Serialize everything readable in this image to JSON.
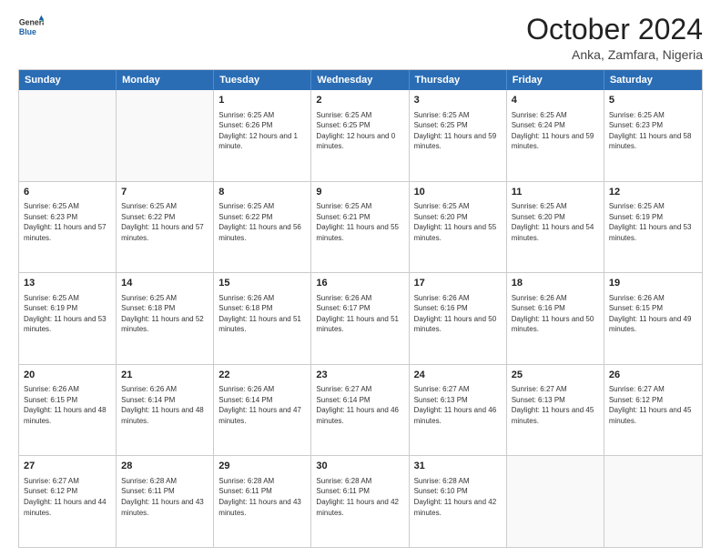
{
  "logo": {
    "line1": "General",
    "line2": "Blue"
  },
  "title": "October 2024",
  "location": "Anka, Zamfara, Nigeria",
  "header_days": [
    "Sunday",
    "Monday",
    "Tuesday",
    "Wednesday",
    "Thursday",
    "Friday",
    "Saturday"
  ],
  "weeks": [
    [
      {
        "day": "",
        "empty": true
      },
      {
        "day": "",
        "empty": true
      },
      {
        "day": "1",
        "rise": "6:25 AM",
        "set": "6:26 PM",
        "daylight": "12 hours and 1 minute."
      },
      {
        "day": "2",
        "rise": "6:25 AM",
        "set": "6:25 PM",
        "daylight": "12 hours and 0 minutes."
      },
      {
        "day": "3",
        "rise": "6:25 AM",
        "set": "6:25 PM",
        "daylight": "11 hours and 59 minutes."
      },
      {
        "day": "4",
        "rise": "6:25 AM",
        "set": "6:24 PM",
        "daylight": "11 hours and 59 minutes."
      },
      {
        "day": "5",
        "rise": "6:25 AM",
        "set": "6:23 PM",
        "daylight": "11 hours and 58 minutes."
      }
    ],
    [
      {
        "day": "6",
        "rise": "6:25 AM",
        "set": "6:23 PM",
        "daylight": "11 hours and 57 minutes."
      },
      {
        "day": "7",
        "rise": "6:25 AM",
        "set": "6:22 PM",
        "daylight": "11 hours and 57 minutes."
      },
      {
        "day": "8",
        "rise": "6:25 AM",
        "set": "6:22 PM",
        "daylight": "11 hours and 56 minutes."
      },
      {
        "day": "9",
        "rise": "6:25 AM",
        "set": "6:21 PM",
        "daylight": "11 hours and 55 minutes."
      },
      {
        "day": "10",
        "rise": "6:25 AM",
        "set": "6:20 PM",
        "daylight": "11 hours and 55 minutes."
      },
      {
        "day": "11",
        "rise": "6:25 AM",
        "set": "6:20 PM",
        "daylight": "11 hours and 54 minutes."
      },
      {
        "day": "12",
        "rise": "6:25 AM",
        "set": "6:19 PM",
        "daylight": "11 hours and 53 minutes."
      }
    ],
    [
      {
        "day": "13",
        "rise": "6:25 AM",
        "set": "6:19 PM",
        "daylight": "11 hours and 53 minutes."
      },
      {
        "day": "14",
        "rise": "6:25 AM",
        "set": "6:18 PM",
        "daylight": "11 hours and 52 minutes."
      },
      {
        "day": "15",
        "rise": "6:26 AM",
        "set": "6:18 PM",
        "daylight": "11 hours and 51 minutes."
      },
      {
        "day": "16",
        "rise": "6:26 AM",
        "set": "6:17 PM",
        "daylight": "11 hours and 51 minutes."
      },
      {
        "day": "17",
        "rise": "6:26 AM",
        "set": "6:16 PM",
        "daylight": "11 hours and 50 minutes."
      },
      {
        "day": "18",
        "rise": "6:26 AM",
        "set": "6:16 PM",
        "daylight": "11 hours and 50 minutes."
      },
      {
        "day": "19",
        "rise": "6:26 AM",
        "set": "6:15 PM",
        "daylight": "11 hours and 49 minutes."
      }
    ],
    [
      {
        "day": "20",
        "rise": "6:26 AM",
        "set": "6:15 PM",
        "daylight": "11 hours and 48 minutes."
      },
      {
        "day": "21",
        "rise": "6:26 AM",
        "set": "6:14 PM",
        "daylight": "11 hours and 48 minutes."
      },
      {
        "day": "22",
        "rise": "6:26 AM",
        "set": "6:14 PM",
        "daylight": "11 hours and 47 minutes."
      },
      {
        "day": "23",
        "rise": "6:27 AM",
        "set": "6:14 PM",
        "daylight": "11 hours and 46 minutes."
      },
      {
        "day": "24",
        "rise": "6:27 AM",
        "set": "6:13 PM",
        "daylight": "11 hours and 46 minutes."
      },
      {
        "day": "25",
        "rise": "6:27 AM",
        "set": "6:13 PM",
        "daylight": "11 hours and 45 minutes."
      },
      {
        "day": "26",
        "rise": "6:27 AM",
        "set": "6:12 PM",
        "daylight": "11 hours and 45 minutes."
      }
    ],
    [
      {
        "day": "27",
        "rise": "6:27 AM",
        "set": "6:12 PM",
        "daylight": "11 hours and 44 minutes."
      },
      {
        "day": "28",
        "rise": "6:28 AM",
        "set": "6:11 PM",
        "daylight": "11 hours and 43 minutes."
      },
      {
        "day": "29",
        "rise": "6:28 AM",
        "set": "6:11 PM",
        "daylight": "11 hours and 43 minutes."
      },
      {
        "day": "30",
        "rise": "6:28 AM",
        "set": "6:11 PM",
        "daylight": "11 hours and 42 minutes."
      },
      {
        "day": "31",
        "rise": "6:28 AM",
        "set": "6:10 PM",
        "daylight": "11 hours and 42 minutes."
      },
      {
        "day": "",
        "empty": true
      },
      {
        "day": "",
        "empty": true
      }
    ]
  ],
  "labels": {
    "sunrise": "Sunrise:",
    "sunset": "Sunset:",
    "daylight": "Daylight:"
  }
}
